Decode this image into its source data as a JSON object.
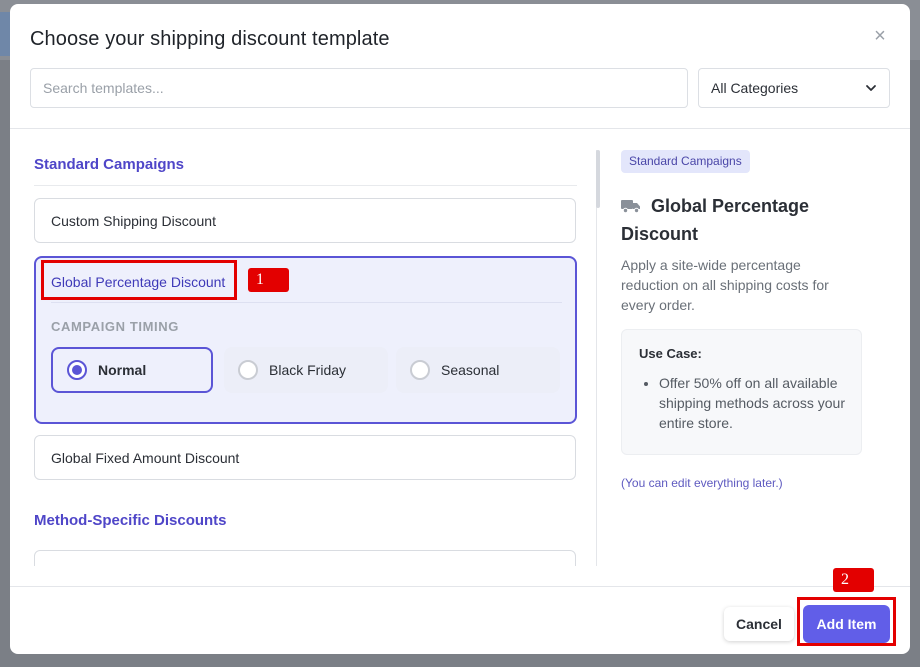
{
  "modal": {
    "title": "Choose your shipping discount template",
    "close_glyph": "×"
  },
  "search": {
    "placeholder": "Search templates...",
    "value": ""
  },
  "category_select": {
    "selected": "All Categories"
  },
  "sections": [
    {
      "title": "Standard Campaigns",
      "templates": [
        "Custom Shipping Discount",
        "Global Percentage Discount",
        "Global Fixed Amount Discount"
      ]
    },
    {
      "title": "Method-Specific Discounts",
      "templates": [
        ""
      ]
    }
  ],
  "expanded_template": {
    "title": "Global Percentage Discount",
    "timing_label": "CAMPAIGN TIMING",
    "options": [
      "Normal",
      "Black Friday",
      "Seasonal"
    ],
    "selected_option": "Normal"
  },
  "detail": {
    "badge": "Standard Campaigns",
    "icon": "truck-icon",
    "title": "Global Percentage Discount",
    "description": "Apply a site-wide percentage reduction on all shipping costs for every order.",
    "use_case_label": "Use Case:",
    "use_case_items": [
      "Offer 50% off on all available shipping methods across your entire store."
    ],
    "edit_note": "(You can edit everything later.)"
  },
  "footer": {
    "cancel_label": "Cancel",
    "add_label": "Add Item"
  },
  "annotations": [
    "1",
    "2"
  ],
  "colors": {
    "accent": "#5b55d6",
    "primary_button": "#615ee8",
    "annotation": "#e30000",
    "section_heading": "#4f46c8"
  }
}
